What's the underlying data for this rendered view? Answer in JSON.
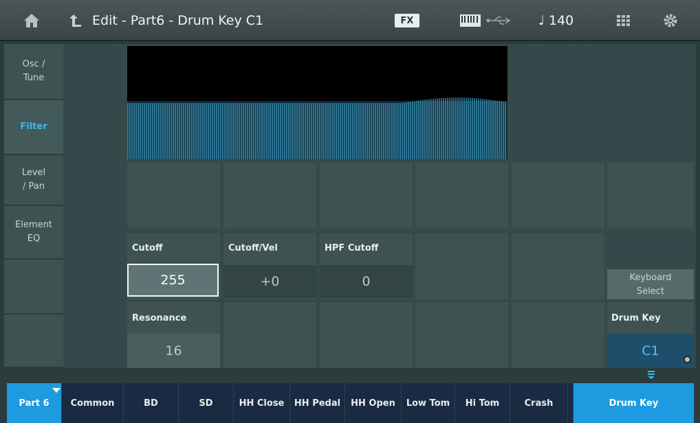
{
  "header": {
    "title": "Edit - Part6 - Drum Key C1",
    "fx_label": "FX",
    "tempo": "♩ 140"
  },
  "left_tabs": [
    {
      "label": "Osc /\nTune",
      "active": false
    },
    {
      "label": "Filter",
      "active": true
    },
    {
      "label": "Level\n/ Pan",
      "active": false
    },
    {
      "label": "Element\nEQ",
      "active": false
    }
  ],
  "params": {
    "cutoff": {
      "label": "Cutoff",
      "value": "255"
    },
    "cutoff_vel": {
      "label": "Cutoff/Vel",
      "value": "+0"
    },
    "hpf_cutoff": {
      "label": "HPF Cutoff",
      "value": "0"
    },
    "resonance": {
      "label": "Resonance",
      "value": "16"
    }
  },
  "side": {
    "keyboard_select": "Keyboard\nSelect",
    "drum_key_label": "Drum Key",
    "drum_key_value": "C1"
  },
  "bottom_tabs": [
    {
      "label": "Part 6",
      "active": true
    },
    {
      "label": "Common",
      "active": false
    },
    {
      "label": "BD",
      "active": false
    },
    {
      "label": "SD",
      "active": false
    },
    {
      "label": "HH Close",
      "active": false
    },
    {
      "label": "HH Pedal",
      "active": false
    },
    {
      "label": "HH Open",
      "active": false
    },
    {
      "label": "Low Tom",
      "active": false
    },
    {
      "label": "Hi Tom",
      "active": false
    },
    {
      "label": "Crash",
      "active": false
    },
    {
      "label": "Drum Key",
      "active": true
    }
  ],
  "colors": {
    "accent": "#1e9be0",
    "waveform": "#4fc3f5"
  },
  "icons": [
    "home-icon",
    "back-arrow-icon",
    "keyboard-icon",
    "usb-icon",
    "grid-icon",
    "gear-icon",
    "expand-arrow-icon",
    "collapse-arrow-icon"
  ]
}
